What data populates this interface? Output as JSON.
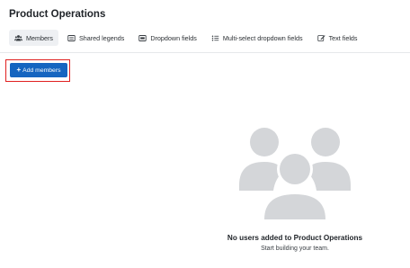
{
  "page": {
    "title": "Product Operations"
  },
  "tabs": [
    {
      "label": "Members",
      "icon": "people-icon",
      "active": true
    },
    {
      "label": "Shared legends",
      "icon": "legend-icon",
      "active": false
    },
    {
      "label": "Dropdown fields",
      "icon": "dropdown-icon",
      "active": false
    },
    {
      "label": "Multi-select dropdown fields",
      "icon": "multiselect-icon",
      "active": false
    },
    {
      "label": "Text fields",
      "icon": "edit-icon",
      "active": false
    }
  ],
  "toolbar": {
    "add_members_label": "Add members"
  },
  "empty_state": {
    "title": "No users added to Product Operations",
    "subtitle": "Start building your team."
  },
  "colors": {
    "primary": "#1565c0",
    "highlight": "#e02020",
    "illustration": "#d4d6d9"
  }
}
